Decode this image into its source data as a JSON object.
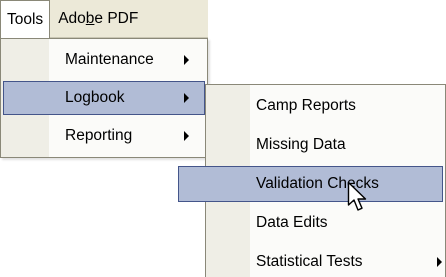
{
  "menubar": {
    "tools_label": "Tools",
    "adobe_pdf_label_pre": "Ado",
    "adobe_pdf_label_ul": "b",
    "adobe_pdf_label_post": "e PDF"
  },
  "tools_menu": {
    "items": [
      {
        "label": "Maintenance",
        "has_submenu": true
      },
      {
        "label": "Logbook",
        "has_submenu": true,
        "highlighted": true
      },
      {
        "label": "Reporting",
        "has_submenu": true
      }
    ]
  },
  "logbook_menu": {
    "items": [
      {
        "label": "Camp Reports"
      },
      {
        "label": "Missing Data"
      },
      {
        "label": "Validation Checks",
        "highlighted": true
      },
      {
        "label": "Data Edits"
      },
      {
        "label": "Statistical Tests",
        "has_submenu": true
      }
    ]
  },
  "colors": {
    "menubar_bg": "#ece9d8",
    "highlight_bg": "#b1bcd6",
    "highlight_border": "#44558a",
    "gutter_bg": "#efeee6"
  },
  "icons": {
    "cursor": "mouse-pointer-icon",
    "submenu_arrow": "chevron-right-icon"
  }
}
